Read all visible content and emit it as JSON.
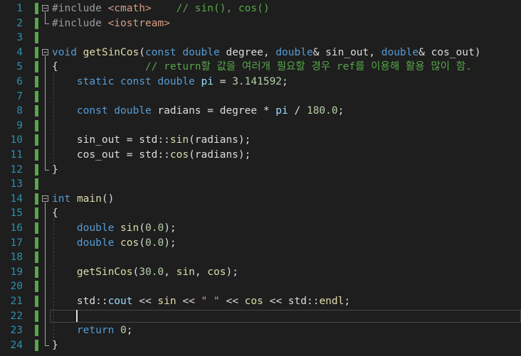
{
  "editor": {
    "lines": [
      {
        "num": "1",
        "tokens": [
          {
            "t": "#include ",
            "c": "pp"
          },
          {
            "t": "<cmath>",
            "c": "str"
          },
          {
            "t": "    ",
            "c": "plain"
          },
          {
            "t": "// sin(), cos()",
            "c": "cm"
          }
        ]
      },
      {
        "num": "2",
        "tokens": [
          {
            "t": "#include ",
            "c": "pp"
          },
          {
            "t": "<iostream>",
            "c": "str"
          }
        ]
      },
      {
        "num": "3",
        "tokens": []
      },
      {
        "num": "4",
        "tokens": [
          {
            "t": "void",
            "c": "kw"
          },
          {
            "t": " ",
            "c": "plain"
          },
          {
            "t": "getSinCos",
            "c": "fn"
          },
          {
            "t": "(",
            "c": "plain"
          },
          {
            "t": "const double",
            "c": "kw"
          },
          {
            "t": " degree, ",
            "c": "plain"
          },
          {
            "t": "double",
            "c": "kw"
          },
          {
            "t": "& sin_out, ",
            "c": "plain"
          },
          {
            "t": "double",
            "c": "kw"
          },
          {
            "t": "& cos_out)",
            "c": "plain"
          }
        ]
      },
      {
        "num": "5",
        "tokens": [
          {
            "t": "{              ",
            "c": "plain"
          },
          {
            "t": "// return할 값을 여러개 필요할 경우 ref를 이용해 활용 많이 함.",
            "c": "cm"
          }
        ]
      },
      {
        "num": "6",
        "tokens": [
          {
            "t": "    ",
            "c": "plain"
          },
          {
            "t": "static const double",
            "c": "kw"
          },
          {
            "t": " ",
            "c": "plain"
          },
          {
            "t": "pi",
            "c": "var"
          },
          {
            "t": " = ",
            "c": "plain"
          },
          {
            "t": "3.141592",
            "c": "num"
          },
          {
            "t": ";",
            "c": "plain"
          }
        ]
      },
      {
        "num": "7",
        "tokens": []
      },
      {
        "num": "8",
        "tokens": [
          {
            "t": "    ",
            "c": "plain"
          },
          {
            "t": "const double",
            "c": "kw"
          },
          {
            "t": " radians = degree * ",
            "c": "plain"
          },
          {
            "t": "pi",
            "c": "var"
          },
          {
            "t": " / ",
            "c": "plain"
          },
          {
            "t": "180.0",
            "c": "num"
          },
          {
            "t": ";",
            "c": "plain"
          }
        ]
      },
      {
        "num": "9",
        "tokens": []
      },
      {
        "num": "10",
        "tokens": [
          {
            "t": "    sin_out = std::",
            "c": "plain"
          },
          {
            "t": "sin",
            "c": "fn"
          },
          {
            "t": "(radians);",
            "c": "plain"
          }
        ]
      },
      {
        "num": "11",
        "tokens": [
          {
            "t": "    cos_out = std::",
            "c": "plain"
          },
          {
            "t": "cos",
            "c": "fn"
          },
          {
            "t": "(radians);",
            "c": "plain"
          }
        ]
      },
      {
        "num": "12",
        "tokens": [
          {
            "t": "}",
            "c": "plain"
          }
        ]
      },
      {
        "num": "13",
        "tokens": []
      },
      {
        "num": "14",
        "tokens": [
          {
            "t": "int",
            "c": "kw"
          },
          {
            "t": " ",
            "c": "plain"
          },
          {
            "t": "main",
            "c": "fn"
          },
          {
            "t": "()",
            "c": "plain"
          }
        ]
      },
      {
        "num": "15",
        "tokens": [
          {
            "t": "{",
            "c": "plain"
          }
        ]
      },
      {
        "num": "16",
        "tokens": [
          {
            "t": "    ",
            "c": "plain"
          },
          {
            "t": "double",
            "c": "kw"
          },
          {
            "t": " ",
            "c": "plain"
          },
          {
            "t": "sin",
            "c": "fn"
          },
          {
            "t": "(",
            "c": "plain"
          },
          {
            "t": "0.0",
            "c": "num"
          },
          {
            "t": ");",
            "c": "plain"
          }
        ]
      },
      {
        "num": "17",
        "tokens": [
          {
            "t": "    ",
            "c": "plain"
          },
          {
            "t": "double",
            "c": "kw"
          },
          {
            "t": " ",
            "c": "plain"
          },
          {
            "t": "cos",
            "c": "fn"
          },
          {
            "t": "(",
            "c": "plain"
          },
          {
            "t": "0.0",
            "c": "num"
          },
          {
            "t": ");",
            "c": "plain"
          }
        ]
      },
      {
        "num": "18",
        "tokens": []
      },
      {
        "num": "19",
        "tokens": [
          {
            "t": "    ",
            "c": "plain"
          },
          {
            "t": "getSinCos",
            "c": "fn"
          },
          {
            "t": "(",
            "c": "plain"
          },
          {
            "t": "30.0",
            "c": "num"
          },
          {
            "t": ", ",
            "c": "plain"
          },
          {
            "t": "sin",
            "c": "fn"
          },
          {
            "t": ", ",
            "c": "plain"
          },
          {
            "t": "cos",
            "c": "fn"
          },
          {
            "t": ");",
            "c": "plain"
          }
        ]
      },
      {
        "num": "20",
        "tokens": []
      },
      {
        "num": "21",
        "tokens": [
          {
            "t": "    std::",
            "c": "plain"
          },
          {
            "t": "cout",
            "c": "var"
          },
          {
            "t": " << ",
            "c": "plain"
          },
          {
            "t": "sin",
            "c": "fn"
          },
          {
            "t": " << ",
            "c": "plain"
          },
          {
            "t": "\" \"",
            "c": "str"
          },
          {
            "t": " << ",
            "c": "plain"
          },
          {
            "t": "cos",
            "c": "fn"
          },
          {
            "t": " << std::",
            "c": "plain"
          },
          {
            "t": "endl",
            "c": "fn"
          },
          {
            "t": ";",
            "c": "plain"
          }
        ]
      },
      {
        "num": "22",
        "tokens": []
      },
      {
        "num": "23",
        "tokens": [
          {
            "t": "    ",
            "c": "plain"
          },
          {
            "t": "return",
            "c": "kw"
          },
          {
            "t": " ",
            "c": "plain"
          },
          {
            "t": "0",
            "c": "num"
          },
          {
            "t": ";",
            "c": "plain"
          }
        ]
      },
      {
        "num": "24",
        "tokens": [
          {
            "t": "}",
            "c": "plain"
          }
        ]
      }
    ],
    "current_line": "22",
    "folded_starts": [
      "1",
      "4",
      "14"
    ],
    "colors": {
      "background": "#1e1e1e",
      "line_number": "#2b91af",
      "keyword": "#569cd6",
      "comment": "#57a64a",
      "function": "#dcdcaa",
      "number": "#b5cea8",
      "string": "#d69d85",
      "changed_bar": "#57a64a"
    }
  }
}
